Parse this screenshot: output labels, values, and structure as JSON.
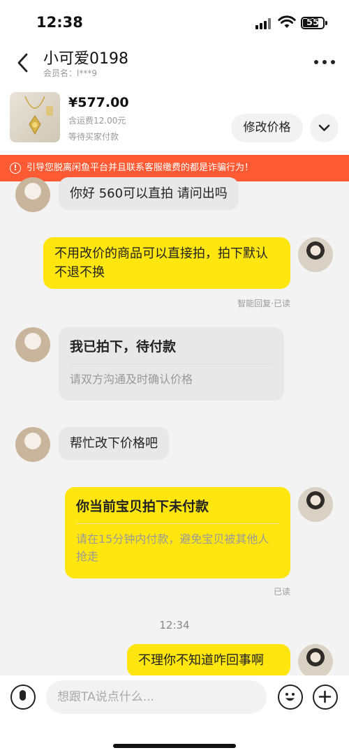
{
  "status_bar": {
    "time": "12:38",
    "battery": "55"
  },
  "header": {
    "name": "小可爱0198",
    "member_line": "会员名：l***9"
  },
  "product": {
    "price": "¥577.00",
    "shipping": "含运费12.00元",
    "status": "等待买家付款",
    "edit_price_label": "修改价格"
  },
  "warning": {
    "text": "引导您脱离闲鱼平台并且联系客服缴费的都是诈骗行为！"
  },
  "messages": [
    {
      "from": "them",
      "text": "你好 560可以直拍  请问出吗"
    },
    {
      "from": "me",
      "text": "不用改价的商品可以直接拍，拍下默认不退不换",
      "meta": "智能回复·已读"
    },
    {
      "from": "them",
      "type": "card",
      "title": "我已拍下，待付款",
      "subtitle": "请双方沟通及时确认价格"
    },
    {
      "from": "them",
      "text": "帮忙改下价格吧"
    },
    {
      "from": "me",
      "type": "card",
      "title": "你当前宝贝拍下未付款",
      "subtitle": "请在15分钟内付款，避免宝贝被其他人抢走",
      "meta": "已读"
    },
    {
      "from": "me",
      "text": "不理你不知道咋回事啊"
    }
  ],
  "chat_time": "12:34",
  "input": {
    "placeholder": "想跟TA说点什么..."
  },
  "colors": {
    "accent_yellow": "#ffe60f",
    "warning_red": "#ff5a33"
  },
  "icons": [
    "back-arrow-icon",
    "more-dots-icon",
    "chevron-down-icon",
    "warning-icon",
    "microphone-icon",
    "emoji-icon",
    "plus-icon"
  ]
}
